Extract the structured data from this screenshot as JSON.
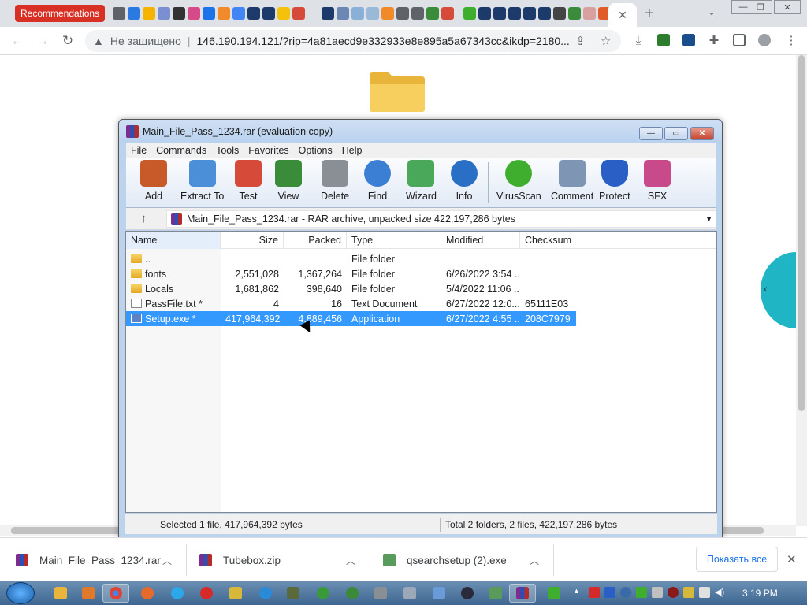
{
  "browser": {
    "recommendations_tab": "Recommendations",
    "new_tab_symbol": "+",
    "address": {
      "warning_icon": "warning-icon",
      "insecure_label": "Не защищено",
      "url": "146.190.194.121/?rip=4a81aecd9e332933e8e895a5a67343cc&ikdp=2180..."
    }
  },
  "winrar": {
    "title": "Main_File_Pass_1234.rar (evaluation copy)",
    "menu": [
      "File",
      "Commands",
      "Tools",
      "Favorites",
      "Options",
      "Help"
    ],
    "tools": [
      {
        "label": "Add",
        "icon": "add-icon",
        "color": "#c85a2a"
      },
      {
        "label": "Extract To",
        "icon": "extract-folder-icon",
        "color": "#4a8fd8"
      },
      {
        "label": "Test",
        "icon": "test-clipboard-icon",
        "color": "#d64a3a"
      },
      {
        "label": "View",
        "icon": "view-book-icon",
        "color": "#3a8c3a"
      },
      {
        "label": "Delete",
        "icon": "delete-trash-icon",
        "color": "#8a8f96"
      },
      {
        "label": "Find",
        "icon": "find-magnifier-icon",
        "color": "#3a7fd4"
      },
      {
        "label": "Wizard",
        "icon": "wizard-wand-icon",
        "color": "#4aa85a"
      },
      {
        "label": "Info",
        "icon": "info-icon",
        "color": "#2a6fc6"
      },
      {
        "label": "VirusScan",
        "icon": "virusscan-icon",
        "color": "#3fae2f"
      },
      {
        "label": "Comment",
        "icon": "comment-icon",
        "color": "#7f95b4"
      },
      {
        "label": "Protect",
        "icon": "protect-shield-icon",
        "color": "#2a5fc6"
      },
      {
        "label": "SFX",
        "icon": "sfx-books-icon",
        "color": "#c84a8a"
      }
    ],
    "address": "Main_File_Pass_1234.rar - RAR archive, unpacked size 422,197,286 bytes",
    "columns": {
      "name": "Name",
      "size": "Size",
      "packed": "Packed",
      "type": "Type",
      "modified": "Modified",
      "checksum": "Checksum"
    },
    "rows": [
      {
        "name": "..",
        "size": "",
        "packed": "",
        "type": "File folder",
        "modified": "",
        "checksum": "",
        "icon": "folder"
      },
      {
        "name": "fonts",
        "size": "2,551,028",
        "packed": "1,367,264",
        "type": "File folder",
        "modified": "6/26/2022 3:54 ...",
        "checksum": "",
        "icon": "folder"
      },
      {
        "name": "Locals",
        "size": "1,681,862",
        "packed": "398,640",
        "type": "File folder",
        "modified": "5/4/2022 11:06 ...",
        "checksum": "",
        "icon": "folder"
      },
      {
        "name": "PassFile.txt *",
        "size": "4",
        "packed": "16",
        "type": "Text Document",
        "modified": "6/27/2022 12:0...",
        "checksum": "65111E03",
        "icon": "txt"
      },
      {
        "name": "Setup.exe *",
        "size": "417,964,392",
        "packed": "4,889,456",
        "type": "Application",
        "modified": "6/27/2022 4:55 ...",
        "checksum": "208C7979",
        "icon": "exe",
        "selected": true
      }
    ],
    "status_left": "Selected 1 file, 417,964,392 bytes",
    "status_right": "Total 2 folders, 2 files, 422,197,286 bytes"
  },
  "downloads": {
    "items": [
      {
        "name": "Main_File_Pass_1234.rar",
        "icon": "winrar-icon"
      },
      {
        "name": "Tubebox.zip",
        "icon": "winrar-icon"
      },
      {
        "name": "qsearchsetup (2).exe",
        "icon": "installer-icon"
      }
    ],
    "show_all": "Показать все"
  },
  "taskbar": {
    "clock": "3:19 PM"
  },
  "colors": {
    "selection": "#3399ff",
    "recommendations_red": "#d93025",
    "teal": "#1fb5c4"
  }
}
